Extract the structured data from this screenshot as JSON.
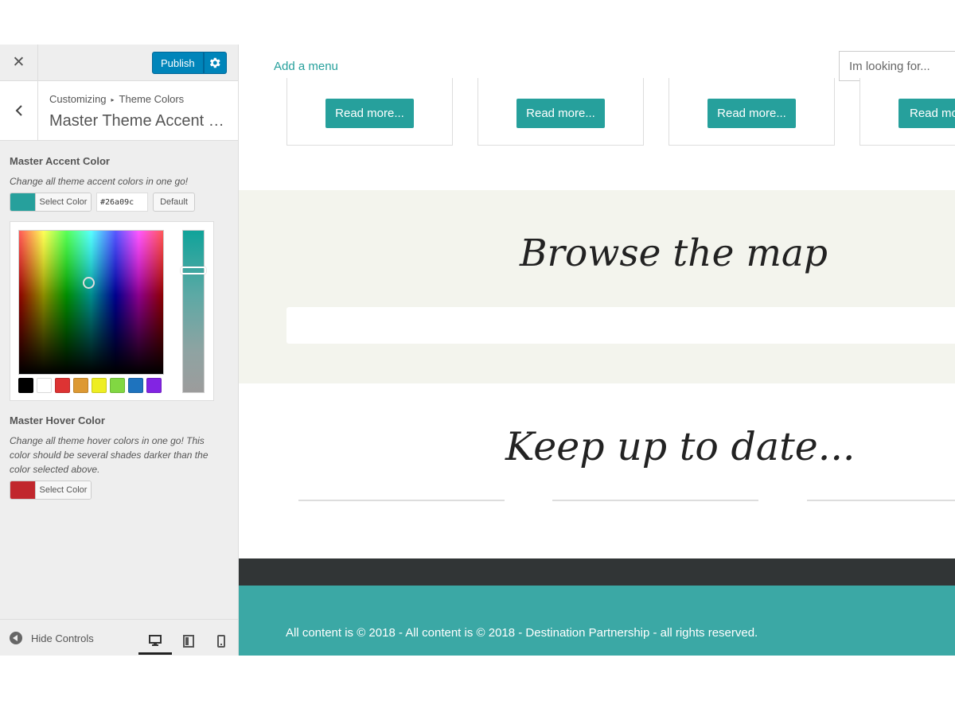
{
  "topbar": {
    "close_label": "✕",
    "publish_label": "Publish"
  },
  "section": {
    "breadcrumb_root": "Customizing",
    "breadcrumb_separator": "▸",
    "breadcrumb_current": "Theme Colors",
    "title": "Master Theme Accent Colors"
  },
  "accent": {
    "title": "Master Accent Color",
    "description": "Change all theme accent colors in one go!",
    "select_label": "Select Color",
    "hex_value": "#26a09c",
    "default_label": "Default",
    "color": "#26a09c",
    "palette": [
      "#000000",
      "#ffffff",
      "#dd3333",
      "#dd9933",
      "#eeee22",
      "#81d742",
      "#1e73be",
      "#8224e3"
    ]
  },
  "hover": {
    "title": "Master Hover Color",
    "description": "Change all theme hover colors in one go! This color should be several shades darker than the color selected above.",
    "select_label": "Select Color",
    "color": "#c1272d"
  },
  "footer_controls": {
    "hide_label": "Hide Controls",
    "devices": [
      "desktop-icon",
      "tablet-icon",
      "mobile-icon"
    ],
    "active_device": "desktop"
  },
  "preview": {
    "nav_link": "Add a menu",
    "search_placeholder": "Im looking for...",
    "cards": [
      {
        "button": "Read more..."
      },
      {
        "button": "Read more..."
      },
      {
        "button": "Read more..."
      },
      {
        "button": "Read more..."
      }
    ],
    "map_heading": "Browse the map",
    "newsletter_heading": "Keep up to date...",
    "copyright": "All content is © 2018 - All content is © 2018 - Destination Partnership - all rights reserved."
  },
  "colors": {
    "accent": "#26a09c",
    "publish": "#0085ba",
    "footer_dark": "#313536",
    "footer_teal": "#3ba8a5",
    "map_bg": "#f3f4ed"
  }
}
